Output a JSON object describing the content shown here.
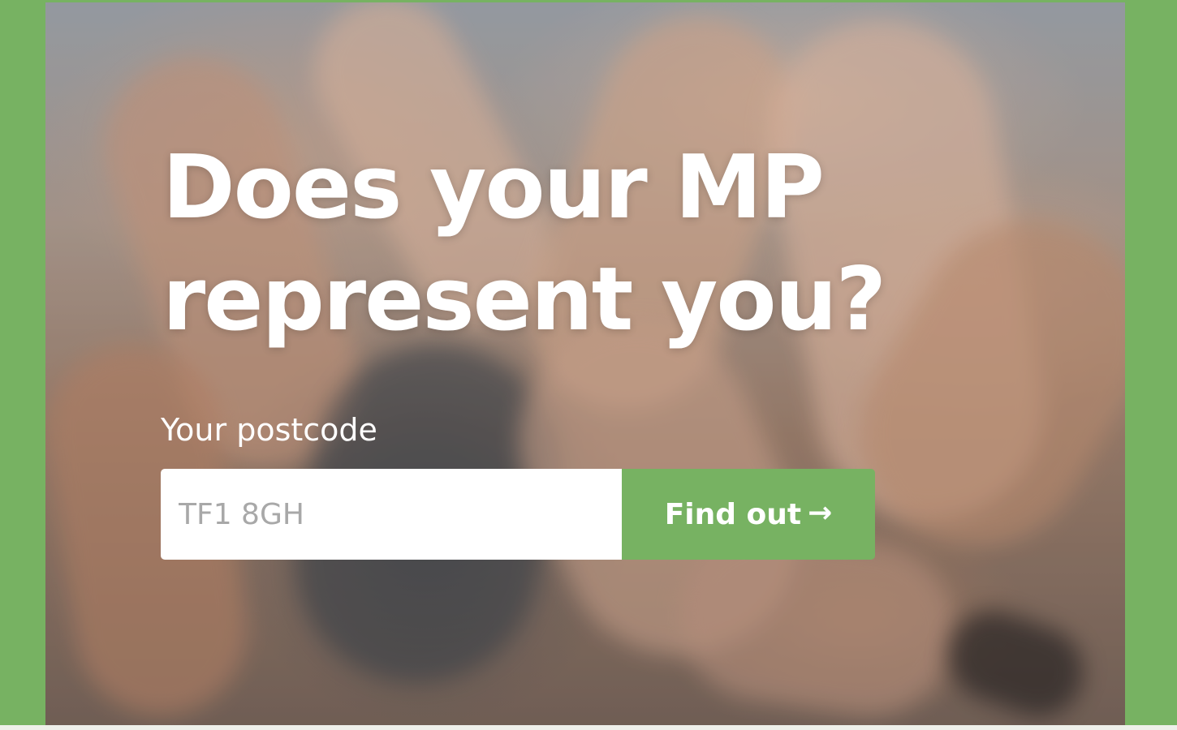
{
  "hero": {
    "title": "Does your MP represent you?"
  },
  "form": {
    "label": "Your postcode",
    "input_placeholder": "TF1 8GH",
    "input_value": "",
    "button_label": "Find out",
    "button_arrow": "→"
  },
  "colors": {
    "accent": "#77b262",
    "text_on_image": "#ffffff",
    "input_background": "#ffffff",
    "placeholder": "#a8a8a8",
    "footer_strip": "#eef0ea"
  },
  "icons": {
    "submit_arrow": "right-arrow-icon"
  }
}
